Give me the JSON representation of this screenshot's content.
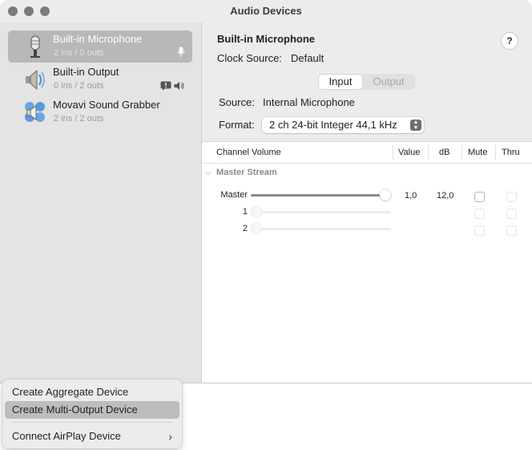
{
  "window": {
    "title": "Audio Devices"
  },
  "sidebar": {
    "devices": [
      {
        "name": "Built-in Microphone",
        "io": "2 ins / 0 outs",
        "icon": "microphone-icon",
        "selected": true
      },
      {
        "name": "Built-in Output",
        "io": "0 ins / 2 outs",
        "icon": "speaker-icon",
        "selected": false
      },
      {
        "name": "Movavi Sound Grabber",
        "io": "2 ins / 2 outs",
        "icon": "movavi-speaker-icon",
        "selected": false
      }
    ],
    "bottom": {
      "add": "+",
      "remove": "−",
      "gear": "⚙",
      "more": "⌄"
    }
  },
  "detail": {
    "title": "Built-in Microphone",
    "help": "?",
    "clock_label": "Clock Source:",
    "clock_value": "Default",
    "tabs": {
      "input": "Input",
      "output": "Output",
      "selected": "Input"
    },
    "source_label": "Source:",
    "source_value": "Internal Microphone",
    "format_label": "Format:",
    "format_value": "2 ch 24-bit Integer 44,1 kHz",
    "table": {
      "headers": [
        "Channel Volume",
        "Value",
        "dB",
        "Mute",
        "Thru"
      ],
      "group": "Master Stream",
      "rows": [
        {
          "label": "Master",
          "level": 1.0,
          "value": "1,0",
          "db": "12,0",
          "enabled": true
        },
        {
          "label": "1",
          "level": 0.0,
          "value": "",
          "db": "",
          "enabled": false
        },
        {
          "label": "2",
          "level": 0.0,
          "value": "",
          "db": "",
          "enabled": false
        }
      ]
    }
  },
  "menu": {
    "items": [
      "Create Aggregate Device",
      "Create Multi-Output Device",
      "Connect AirPlay Device"
    ],
    "highlighted": "Create Multi-Output Device",
    "submenu_chevron": "›"
  },
  "colors": {
    "selection": "#b8b8b8",
    "menu_highlight": "#bdbdbd",
    "icon_blue": "#4a90d9"
  }
}
